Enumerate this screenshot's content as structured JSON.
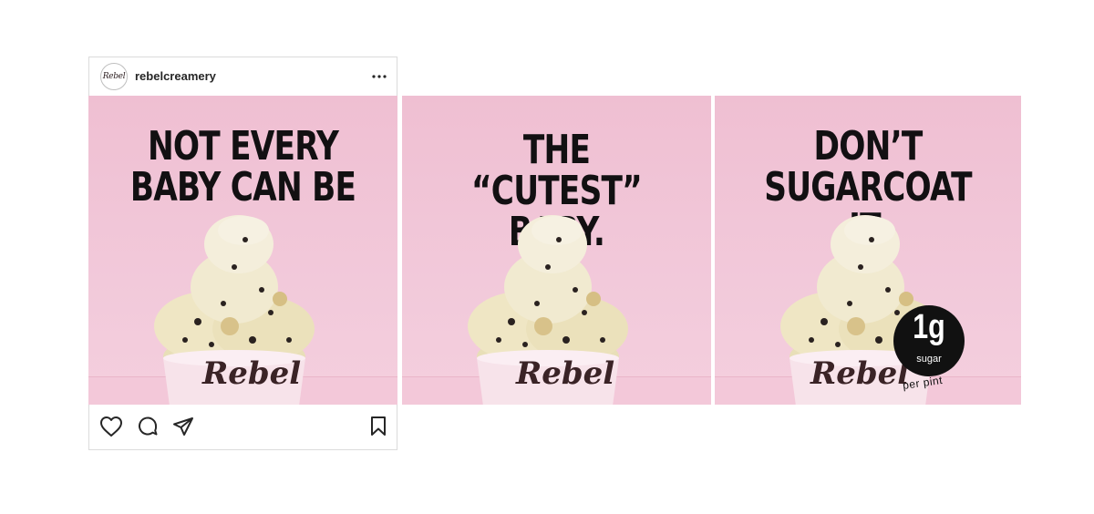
{
  "post": {
    "username": "rebelcreamery",
    "avatar_text": "Rebel",
    "more_icon": "more-horizontal-icon"
  },
  "slides": [
    {
      "lines": [
        "NOT EVERY",
        "BABY CAN BE"
      ],
      "cup_brand": "Rebel"
    },
    {
      "lines": [
        "THE",
        "“CUTEST” BABY."
      ],
      "cup_brand": "Rebel"
    },
    {
      "lines": [
        "DON’T",
        "SUGARCOAT IT."
      ],
      "cup_brand": "Rebel",
      "badge": {
        "amount": "1g",
        "label": "sugar",
        "sub": "per pint"
      }
    }
  ],
  "actions": {
    "icons": [
      "heart-icon",
      "comment-icon",
      "share-icon",
      "bookmark-icon"
    ]
  },
  "colors": {
    "background_pink": "#f2c9da",
    "headline": "#121012",
    "cup": "#f7e3ea"
  }
}
